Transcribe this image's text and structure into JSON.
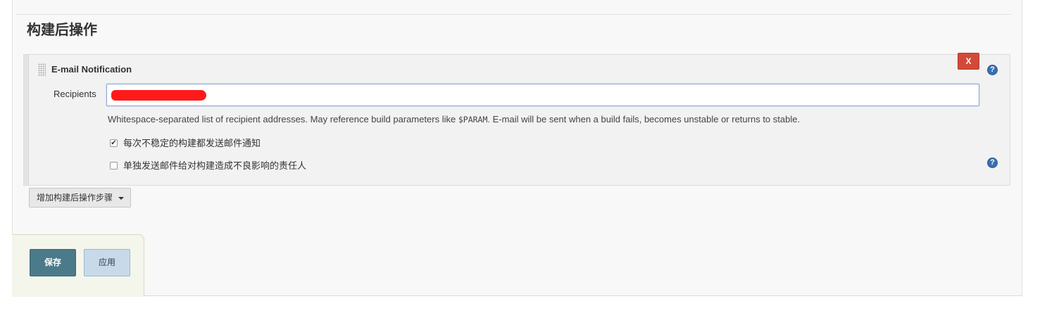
{
  "section": {
    "title": "构建后操作"
  },
  "publisher": {
    "title": "E-mail Notification",
    "delete_label": "X",
    "help_label": "?",
    "recipients_label": "Recipients",
    "recipients_value": "",
    "help_text_before": "Whitespace-separated list of recipient addresses. May reference build parameters like ",
    "help_text_code": "$PARAM",
    "help_text_after": ". E-mail will be sent when a build fails, becomes unstable or returns to stable.",
    "options": [
      {
        "label": "每次不稳定的构建都发送邮件通知",
        "checked": true
      },
      {
        "label": "单独发送邮件给对构建造成不良影响的责任人",
        "checked": false
      }
    ]
  },
  "add_step": {
    "label": "增加构建后操作步骤"
  },
  "footer": {
    "save_label": "保存",
    "apply_label": "应用"
  },
  "colors": {
    "delete": "#d24939",
    "help": "#3a6fb0",
    "save": "#4b7a8a",
    "apply": "#c8daea",
    "redaction": "#ff1a1a"
  },
  "icons": {
    "help": "help-icon",
    "drag": "drag-handle-icon",
    "dropdown": "caret-down-icon",
    "checked": "check-icon"
  }
}
